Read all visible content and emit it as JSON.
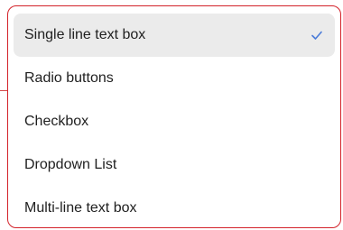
{
  "dropdown": {
    "options": [
      {
        "label": "Single line text box",
        "selected": true
      },
      {
        "label": "Radio buttons",
        "selected": false
      },
      {
        "label": "Checkbox",
        "selected": false
      },
      {
        "label": "Dropdown List",
        "selected": false
      },
      {
        "label": "Multi-line text box",
        "selected": false
      }
    ],
    "check_icon": "checkmark-icon"
  },
  "colors": {
    "border": "#d3222a",
    "selected_bg": "#ebebeb",
    "check": "#4a7bd8",
    "text": "#1f1f1f"
  }
}
